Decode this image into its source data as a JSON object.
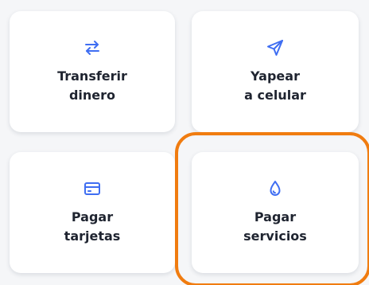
{
  "colors": {
    "accent": "#3f6ef2",
    "text": "#1f2430",
    "highlight": "#f07c10",
    "tile_bg": "#ffffff",
    "page_bg": "#f5f6f8"
  },
  "tiles": [
    {
      "icon": "transfer-arrows-icon",
      "line1": "Transferir",
      "line2": "dinero"
    },
    {
      "icon": "paper-plane-icon",
      "line1": "Yapear",
      "line2": "a celular"
    },
    {
      "icon": "card-icon",
      "line1": "Pagar",
      "line2": "tarjetas"
    },
    {
      "icon": "water-drop-icon",
      "line1": "Pagar",
      "line2": "servicios"
    }
  ]
}
